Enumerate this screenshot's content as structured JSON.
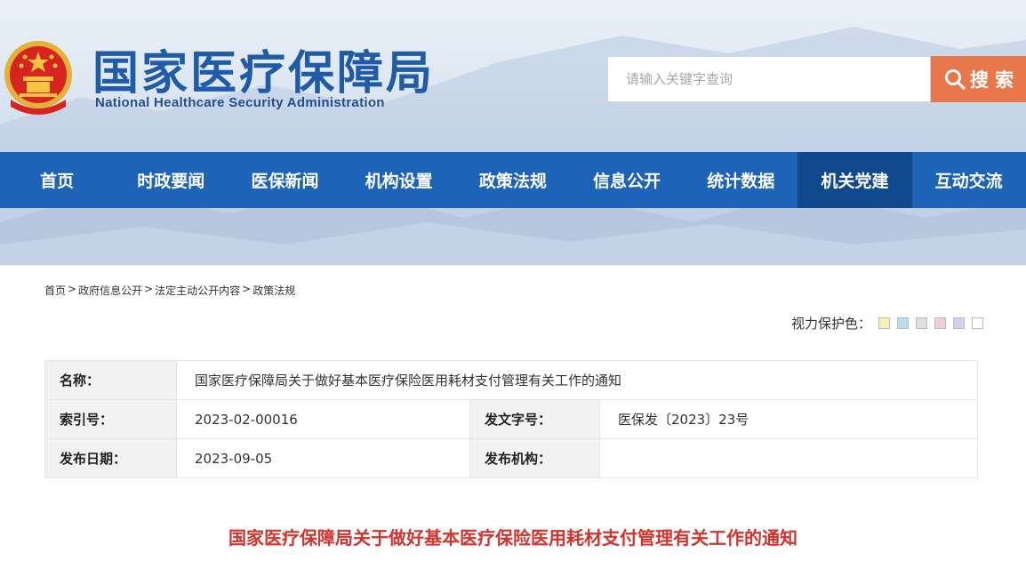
{
  "header": {
    "title_cn": "国家医疗保障局",
    "title_en": "National Healthcare Security Administration",
    "emblem_icon": "national-emblem-icon"
  },
  "search": {
    "placeholder": "请输入关键字查询",
    "button_label": "搜 索",
    "button_color": "#e8784c"
  },
  "nav": {
    "color": "#1d64b9",
    "active_color": "#11498f",
    "items": [
      {
        "label": "首页"
      },
      {
        "label": "时政要闻"
      },
      {
        "label": "医保新闻"
      },
      {
        "label": "机构设置"
      },
      {
        "label": "政策法规"
      },
      {
        "label": "信息公开"
      },
      {
        "label": "统计数据"
      },
      {
        "label": "机关党建",
        "active": true
      },
      {
        "label": "互动交流"
      }
    ]
  },
  "breadcrumb": {
    "items": [
      "首页",
      "政府信息公开",
      "法定主动公开内容",
      "政策法规"
    ],
    "separator": ">"
  },
  "eye_care": {
    "label": "视力保护色：",
    "colors": [
      "#f7f0b8",
      "#b9def0",
      "#dedede",
      "#f4cdd6",
      "#dccbf0",
      "#ffffff"
    ]
  },
  "meta": {
    "name_label": "名称：",
    "name_value": "国家医疗保障局关于做好基本医疗保险医用耗材支付管理有关工作的通知",
    "index_label": "索引号：",
    "index_value": "2023-02-00016",
    "doc_no_label": "发文字号：",
    "doc_no_value": "医保发〔2023〕23号",
    "date_label": "发布日期：",
    "date_value": "2023-09-05",
    "org_label": "发布机构：",
    "org_value": ""
  },
  "article": {
    "title": "国家医疗保障局关于做好基本医疗保险医用耗材支付管理有关工作的通知",
    "title_color": "#d6322c"
  }
}
